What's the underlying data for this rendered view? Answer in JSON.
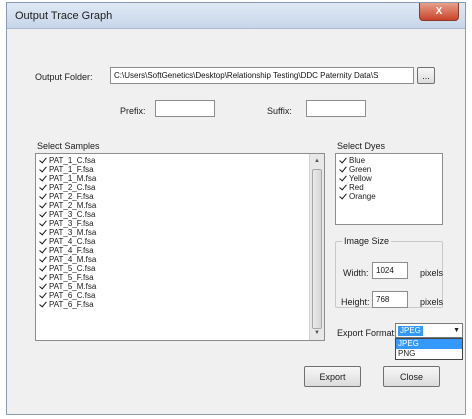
{
  "window": {
    "title": "Output Trace Graph",
    "close_label": "X"
  },
  "output_folder": {
    "label": "Output Folder:",
    "value": "C:\\Users\\SoftGenetics\\Desktop\\Relationship Testing\\DDC Paternity Data\\S",
    "browse_label": "..."
  },
  "prefix": {
    "label": "Prefix:",
    "value": ""
  },
  "suffix": {
    "label": "Suffix:",
    "value": ""
  },
  "samples": {
    "label": "Select Samples",
    "items": [
      "PAT_1_C.fsa",
      "PAT_1_F.fsa",
      "PAT_1_M.fsa",
      "PAT_2_C.fsa",
      "PAT_2_F.fsa",
      "PAT_2_M.fsa",
      "PAT_3_C.fsa",
      "PAT_3_F.fsa",
      "PAT_3_M.fsa",
      "PAT_4_C.fsa",
      "PAT_4_F.fsa",
      "PAT_4_M.fsa",
      "PAT_5_C.fsa",
      "PAT_5_F.fsa",
      "PAT_5_M.fsa",
      "PAT_6_C.fsa",
      "PAT_6_F.fsa"
    ]
  },
  "dyes": {
    "label": "Select Dyes",
    "items": [
      "Blue",
      "Green",
      "Yellow",
      "Red",
      "Orange"
    ]
  },
  "image_size": {
    "label": "Image Size",
    "width_label": "Width:",
    "width_value": "1024",
    "width_unit": "pixels",
    "height_label": "Height:",
    "height_value": "768",
    "height_unit": "pixels"
  },
  "export_format": {
    "label": "Export Format:",
    "selected": "JPEG",
    "options": [
      "JPEG",
      "PNG"
    ]
  },
  "buttons": {
    "export": "Export",
    "close": "Close"
  },
  "colors": {
    "selection": "#3399ff",
    "titlebar": "#c7d6ea",
    "dialog_bg": "#f0f0f0"
  }
}
